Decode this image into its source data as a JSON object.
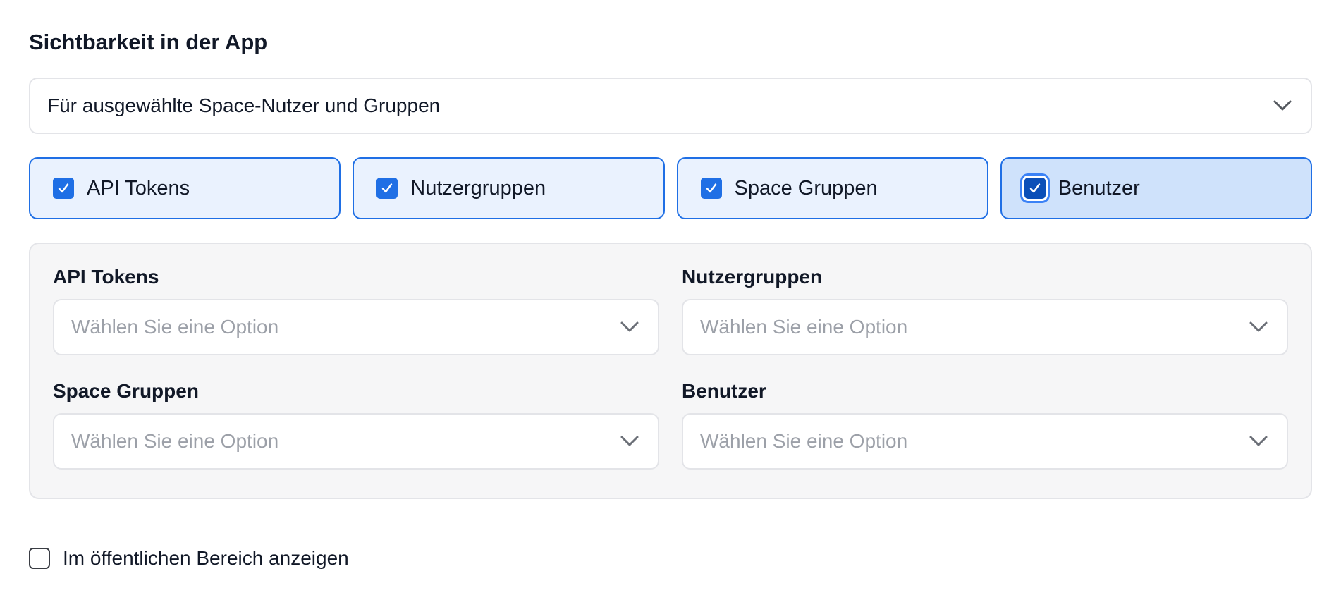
{
  "section": {
    "title": "Sichtbarkeit in der App"
  },
  "visibility_select": {
    "value": "Für ausgewählte Space-Nutzer und Gruppen",
    "icon": "chevron-down-icon"
  },
  "toggles": [
    {
      "label": "API Tokens",
      "checked": true,
      "active": false
    },
    {
      "label": "Nutzergruppen",
      "checked": true,
      "active": false
    },
    {
      "label": "Space Gruppen",
      "checked": true,
      "active": false
    },
    {
      "label": "Benutzer",
      "checked": true,
      "active": true
    }
  ],
  "fields": [
    {
      "label": "API Tokens",
      "placeholder": "Wählen Sie eine Option"
    },
    {
      "label": "Nutzergruppen",
      "placeholder": "Wählen Sie eine Option"
    },
    {
      "label": "Space Gruppen",
      "placeholder": "Wählen Sie eine Option"
    },
    {
      "label": "Benutzer",
      "placeholder": "Wählen Sie eine Option"
    }
  ],
  "public_area": {
    "label": "Im öffentlichen Bereich anzeigen",
    "checked": false
  },
  "colors": {
    "accent": "#1f6fe5",
    "toggle_bg": "#eaf2fe",
    "toggle_active_bg": "#cfe2fb",
    "panel_bg": "#f6f6f7",
    "placeholder": "#9ca0a8"
  }
}
